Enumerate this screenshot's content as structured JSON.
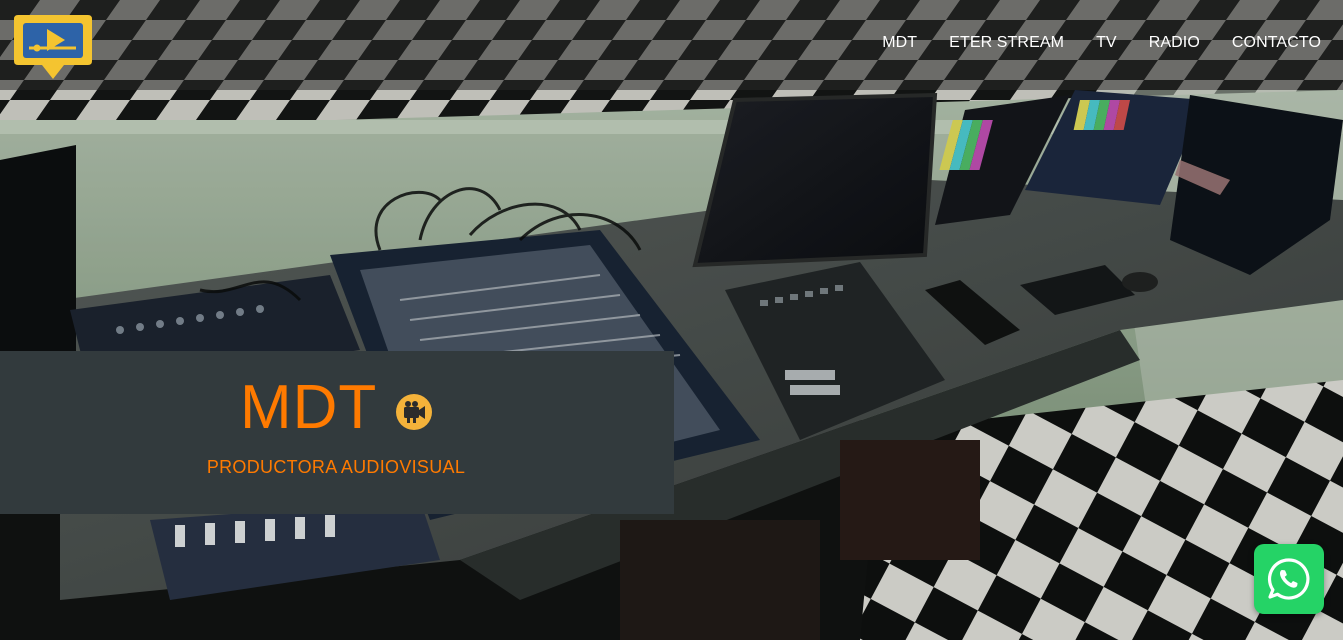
{
  "brand": {
    "logo_icon": "play-screen-logo-icon",
    "logo_color": "#f4c430"
  },
  "nav": {
    "items": [
      {
        "label": "MDT"
      },
      {
        "label": "ETER STREAM"
      },
      {
        "label": "TV"
      },
      {
        "label": "RADIO"
      },
      {
        "label": "CONTACTO"
      }
    ]
  },
  "hero": {
    "title": "MDT",
    "title_icon": "video-camera-icon",
    "subtitle": "PRODUCTORA AUDIOVISUAL",
    "accent_color": "#ff7a00",
    "card_color": "#323a3d"
  },
  "whatsapp": {
    "icon": "whatsapp-icon",
    "color": "#25d366"
  }
}
